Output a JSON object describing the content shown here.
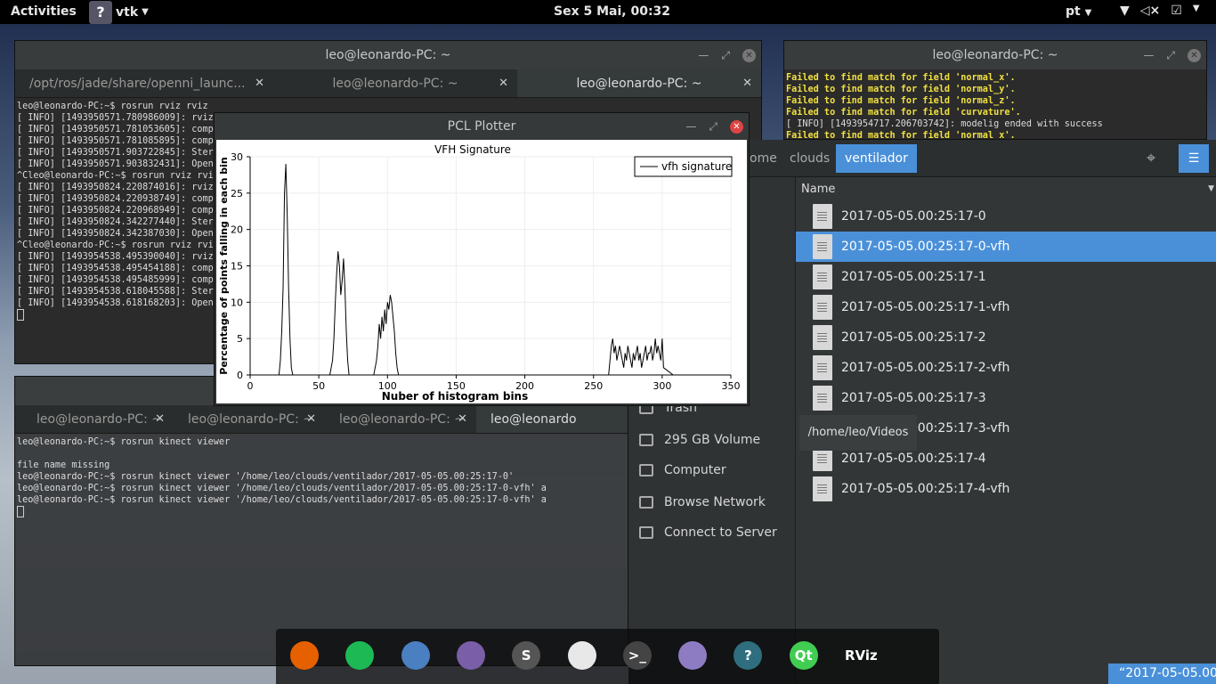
{
  "topbar": {
    "activities": "Activities",
    "app_name": "vtk",
    "clock": "Sex  5 Mai, 00:32",
    "language": "pt"
  },
  "terminal1": {
    "title": "leo@leonardo-PC: ~",
    "tabs": [
      {
        "label": "/opt/ros/jade/share/openni_launc..."
      },
      {
        "label": "leo@leonardo-PC: ~"
      },
      {
        "label": "leo@leonardo-PC: ~"
      }
    ],
    "lines": [
      "leo@leonardo-PC:~$ rosrun rviz rviz",
      "[ INFO] [1493950571.780986009]: rviz",
      "[ INFO] [1493950571.781053605]: compi",
      "[ INFO] [1493950571.781085895]: compi",
      "[ INFO] [1493950571.903722845]: Stere",
      "[ INFO] [1493950571.903832431]: OpenG",
      "^Cleo@leonardo-PC:~$ rosrun rviz rviz",
      "[ INFO] [1493950824.220874016]: rviz",
      "[ INFO] [1493950824.220938749]: compi",
      "[ INFO] [1493950824.220968949]: compi",
      "[ INFO] [1493950824.342277440]: Stere",
      "[ INFO] [1493950824.342387030]: OpenG",
      "^Cleo@leonardo-PC:~$ rosrun rviz rviz",
      "[ INFO] [1493954538.495390040]: rviz",
      "[ INFO] [1493954538.495454188]: compi",
      "[ INFO] [1493954538.495485999]: compi",
      "[ INFO] [1493954538.618045588]: Stere",
      "[ INFO] [1493954538.618168203]: OpenG"
    ]
  },
  "terminal2": {
    "tabs": [
      {
        "label": "leo@leonardo-PC: ~"
      },
      {
        "label": "leo@leonardo-PC: ~"
      },
      {
        "label": "leo@leonardo-PC: ~"
      },
      {
        "label": "leo@leonardo"
      }
    ],
    "lines": [
      "leo@leonardo-PC:~$ rosrun kinect viewer",
      "",
      "file name missing",
      "leo@leonardo-PC:~$ rosrun kinect viewer '/home/leo/clouds/ventilador/2017-05-05.00:25:17-0'",
      "leo@leonardo-PC:~$ rosrun kinect viewer '/home/leo/clouds/ventilador/2017-05-05.00:25:17-0-vfh' a",
      "leo@leonardo-PC:~$ rosrun kinect viewer '/home/leo/clouds/ventilador/2017-05-05.00:25:17-0-vfh' a"
    ]
  },
  "terminal3": {
    "title": "leo@leonardo-PC: ~",
    "lines": [
      "Failed to find match for field 'normal_x'.",
      "Failed to find match for field 'normal_y'.",
      "Failed to find match for field 'normal_z'.",
      "Failed to find match for field 'curvature'.",
      "[ INFO] [1493954717.206703742]: modelig ended with success",
      "Failed to find match for field 'normal_x'."
    ]
  },
  "pcl": {
    "window_title": "PCL Plotter"
  },
  "chart_data": {
    "type": "line",
    "title": "VFH Signature",
    "xlabel": "Nuber of histogram bins",
    "ylabel": "Percentage of points falling in each bin",
    "xlim": [
      0,
      350
    ],
    "ylim": [
      0,
      30
    ],
    "xticks": [
      0,
      50,
      100,
      150,
      200,
      250,
      300,
      350
    ],
    "yticks": [
      0,
      5,
      10,
      15,
      20,
      25,
      30
    ],
    "grid": true,
    "legend_position": "top-right",
    "series": [
      {
        "name": "vfh signature",
        "color": "#000000",
        "x": [
          0,
          21,
          22,
          23,
          24,
          25,
          26,
          27,
          28,
          29,
          30,
          31,
          58,
          60,
          61,
          62,
          63,
          64,
          65,
          66,
          67,
          68,
          69,
          70,
          71,
          72,
          90,
          92,
          93,
          94,
          95,
          96,
          97,
          98,
          99,
          100,
          101,
          102,
          103,
          104,
          105,
          106,
          107,
          108,
          261,
          262,
          263,
          264,
          265,
          266,
          267,
          268,
          269,
          270,
          271,
          272,
          273,
          274,
          275,
          276,
          277,
          278,
          279,
          280,
          281,
          282,
          283,
          284,
          285,
          286,
          287,
          288,
          289,
          290,
          291,
          292,
          293,
          294,
          295,
          296,
          297,
          298,
          299,
          300,
          301,
          308
        ],
        "y": [
          0,
          0,
          2,
          6,
          12,
          25,
          29,
          22,
          12,
          5,
          1,
          0,
          0,
          2,
          5,
          10,
          14,
          17,
          15,
          11,
          13,
          16,
          12,
          6,
          2,
          0,
          0,
          2,
          4,
          7,
          5,
          8,
          6,
          9,
          7,
          10,
          9,
          11,
          10,
          8,
          6,
          3,
          1,
          0,
          0,
          2,
          4,
          5,
          3,
          4,
          2,
          3,
          4,
          3,
          2,
          1,
          3,
          2,
          4,
          3,
          2,
          1,
          3,
          2,
          3,
          4,
          2,
          3,
          1,
          2,
          3,
          4,
          2,
          3,
          3,
          4,
          2,
          3,
          5,
          3,
          4,
          3,
          2,
          5,
          1,
          0
        ]
      }
    ]
  },
  "file_manager": {
    "path_buttons": [
      "ome",
      "clouds",
      "ventilador"
    ],
    "column_name": "Name",
    "sidebar": [
      {
        "label": "Trash"
      },
      {
        "label": "295 GB Volume"
      },
      {
        "label": "Computer"
      },
      {
        "label": "Browse Network"
      },
      {
        "label": "Connect to Server"
      }
    ],
    "files": [
      {
        "name": "2017-05-05.00:25:17-0"
      },
      {
        "name": "2017-05-05.00:25:17-0-vfh"
      },
      {
        "name": "2017-05-05.00:25:17-1"
      },
      {
        "name": "2017-05-05.00:25:17-1-vfh"
      },
      {
        "name": "2017-05-05.00:25:17-2"
      },
      {
        "name": "2017-05-05.00:25:17-2-vfh"
      },
      {
        "name": "2017-05-05.00:25:17-3"
      },
      {
        "name": "2017-05-05.00:25:17-3-vfh"
      },
      {
        "name": "2017-05-05.00:25:17-4"
      },
      {
        "name": "2017-05-05.00:25:17-4-vfh"
      }
    ],
    "selected_index": 1,
    "tooltip": "/home/leo/Videos",
    "status": "“2017-05-05.00"
  },
  "dock": {
    "items": [
      {
        "icon": "firefox-icon",
        "glyph": "",
        "color": "#e66000"
      },
      {
        "icon": "spotify-icon",
        "glyph": "",
        "color": "#1db954"
      },
      {
        "icon": "chromium-icon",
        "glyph": "",
        "color": "#4a7fc1"
      },
      {
        "icon": "files-icon",
        "glyph": "",
        "color": "#7a5ea8"
      },
      {
        "icon": "sublime-text-icon",
        "glyph": "S",
        "color": "#555"
      },
      {
        "icon": "atom-icon",
        "glyph": "",
        "color": "#e8e8e8"
      },
      {
        "icon": "terminal-icon",
        "glyph": ">_",
        "color": "#444"
      },
      {
        "icon": "text-editor-icon",
        "glyph": "",
        "color": "#8e7cc3"
      },
      {
        "icon": "vtk-icon",
        "glyph": "?",
        "color": "#2e6e7e"
      },
      {
        "icon": "qt-creator-icon",
        "glyph": "Qt",
        "color": "#41cd52"
      },
      {
        "icon": "rviz-icon",
        "glyph": "RViz",
        "color": "transparent"
      },
      {
        "icon": "app-grid-icon",
        "glyph": "",
        "color": "transparent"
      }
    ]
  }
}
